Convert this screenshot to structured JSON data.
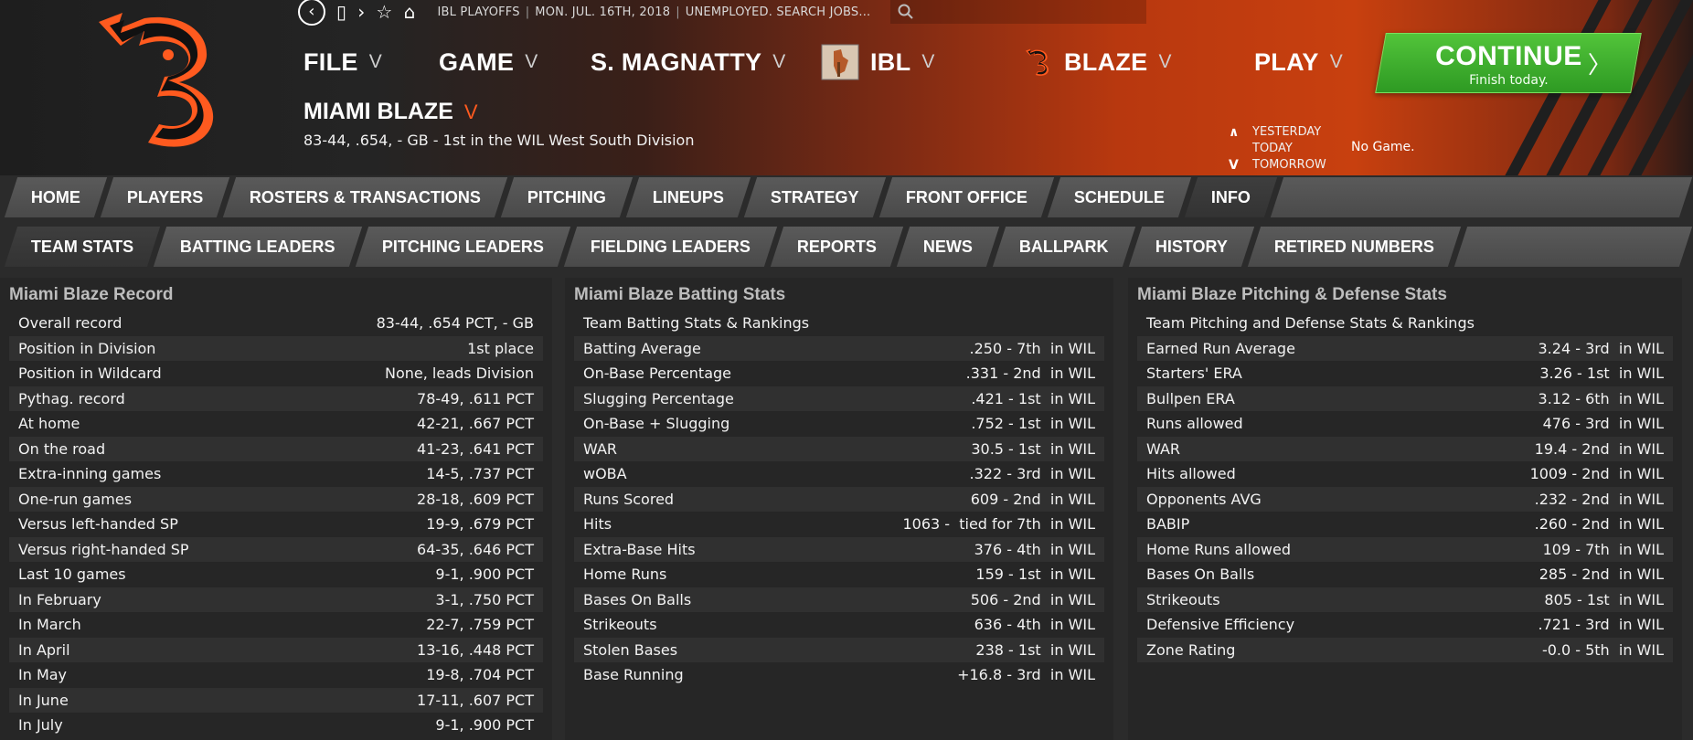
{
  "topbar": {
    "league_phase": "IBL PLAYOFFS",
    "date": "MON. JUL. 16TH, 2018",
    "status_text": "UNEMPLOYED. SEARCH JOBS...",
    "search_placeholder": ""
  },
  "menu": {
    "file": "FILE",
    "game": "GAME",
    "manager": "S. MAGNATTY",
    "league": "IBL",
    "team": "BLAZE",
    "play": "PLAY"
  },
  "team": {
    "name": "MIAMI BLAZE",
    "summary": "83-44, .654, - GB - 1st in the WIL West South Division"
  },
  "continue_button": {
    "label": "CONTINUE",
    "sublabel": "Finish today."
  },
  "day_nav": {
    "yesterday": "YESTERDAY",
    "today": "TODAY",
    "tomorrow": "TOMORROW",
    "game_status": "No Game."
  },
  "tabs_primary": [
    "HOME",
    "PLAYERS",
    "ROSTERS & TRANSACTIONS",
    "PITCHING",
    "LINEUPS",
    "STRATEGY",
    "FRONT OFFICE",
    "SCHEDULE",
    "INFO"
  ],
  "tabs_secondary": [
    "TEAM STATS",
    "BATTING LEADERS",
    "PITCHING LEADERS",
    "FIELDING LEADERS",
    "REPORTS",
    "NEWS",
    "BALLPARK",
    "HISTORY",
    "RETIRED NUMBERS"
  ],
  "record": {
    "title": "Miami Blaze Record",
    "rows": [
      {
        "label": "Overall record",
        "value": "83-44, .654 PCT, - GB"
      },
      {
        "label": "Position in Division",
        "value": "1st place"
      },
      {
        "label": "Position in Wildcard",
        "value": "None, leads Division"
      },
      {
        "label": "Pythag. record",
        "value": "78-49, .611 PCT"
      },
      {
        "label": "At home",
        "value": "42-21, .667 PCT"
      },
      {
        "label": "On the road",
        "value": "41-23, .641 PCT"
      },
      {
        "label": "Extra-inning games",
        "value": "14-5, .737 PCT"
      },
      {
        "label": "One-run games",
        "value": "28-18, .609 PCT"
      },
      {
        "label": "Versus left-handed SP",
        "value": "19-9, .679 PCT"
      },
      {
        "label": "Versus right-handed SP",
        "value": "64-35, .646 PCT"
      },
      {
        "label": "Last 10 games",
        "value": "9-1, .900 PCT"
      },
      {
        "label": "In February",
        "value": "3-1, .750 PCT"
      },
      {
        "label": "In March",
        "value": "22-7, .759 PCT"
      },
      {
        "label": "In April",
        "value": "13-16, .448 PCT"
      },
      {
        "label": "In May",
        "value": "19-8, .704 PCT"
      },
      {
        "label": "In June",
        "value": "17-11, .607 PCT"
      },
      {
        "label": "In July",
        "value": "9-1, .900 PCT"
      }
    ]
  },
  "batting": {
    "title": "Miami Blaze Batting Stats",
    "rows": [
      {
        "label": "Team Batting Stats & Rankings",
        "value": ""
      },
      {
        "label": "Batting Average",
        "value": ".250 - 7th  in WIL"
      },
      {
        "label": "On-Base Percentage",
        "value": ".331 - 2nd  in WIL"
      },
      {
        "label": "Slugging Percentage",
        "value": ".421 - 1st  in WIL"
      },
      {
        "label": "On-Base + Slugging",
        "value": ".752 - 1st  in WIL"
      },
      {
        "label": "WAR",
        "value": "30.5 - 1st  in WIL"
      },
      {
        "label": "wOBA",
        "value": ".322 - 3rd  in WIL"
      },
      {
        "label": "Runs Scored",
        "value": "609 - 2nd  in WIL"
      },
      {
        "label": "Hits",
        "value": "1063 -  tied for 7th  in WIL"
      },
      {
        "label": "Extra-Base Hits",
        "value": "376 - 4th  in WIL"
      },
      {
        "label": "Home Runs",
        "value": "159 - 1st  in WIL"
      },
      {
        "label": "Bases On Balls",
        "value": "506 - 2nd  in WIL"
      },
      {
        "label": "Strikeouts",
        "value": "636 - 4th  in WIL"
      },
      {
        "label": "Stolen Bases",
        "value": "238 - 1st  in WIL"
      },
      {
        "label": "Base Running",
        "value": "+16.8 - 3rd  in WIL"
      }
    ]
  },
  "pitching": {
    "title": "Miami Blaze Pitching & Defense Stats",
    "rows": [
      {
        "label": "Team Pitching and Defense Stats & Rankings",
        "value": ""
      },
      {
        "label": "Earned Run Average",
        "value": "3.24 - 3rd  in WIL"
      },
      {
        "label": "Starters' ERA",
        "value": "3.26 - 1st  in WIL"
      },
      {
        "label": "Bullpen ERA",
        "value": "3.12 - 6th  in WIL"
      },
      {
        "label": "Runs allowed",
        "value": "476 - 3rd  in WIL"
      },
      {
        "label": "WAR",
        "value": "19.4 - 2nd  in WIL"
      },
      {
        "label": "Hits allowed",
        "value": "1009 - 2nd  in WIL"
      },
      {
        "label": "Opponents AVG",
        "value": ".232 - 2nd  in WIL"
      },
      {
        "label": "BABIP",
        "value": ".260 - 2nd  in WIL"
      },
      {
        "label": "Home Runs allowed",
        "value": "109 - 7th  in WIL"
      },
      {
        "label": "Bases On Balls",
        "value": "285 - 2nd  in WIL"
      },
      {
        "label": "Strikeouts",
        "value": "805 - 1st  in WIL"
      },
      {
        "label": "Defensive Efficiency",
        "value": ".721 - 3rd  in WIL"
      },
      {
        "label": "Zone Rating",
        "value": "-0.0 - 5th  in WIL"
      }
    ]
  },
  "colors": {
    "accent_orange": "#c8400f",
    "continue_green": "#2e9a23",
    "panel_bg": "#262626",
    "tab_bg": "#4a4a4a"
  }
}
